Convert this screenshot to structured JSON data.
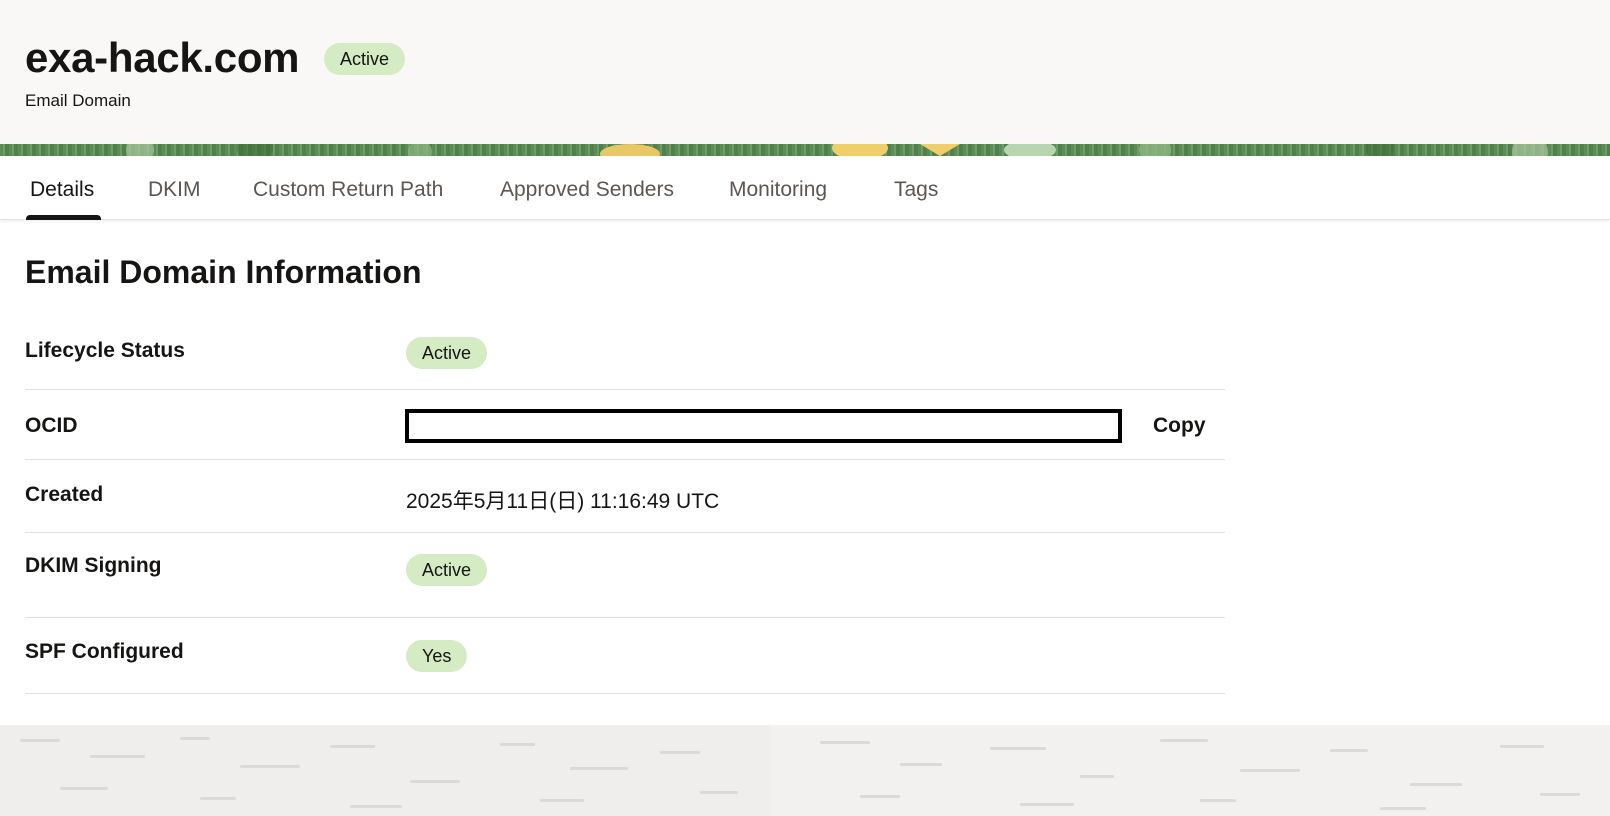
{
  "header": {
    "title": "exa-hack.com",
    "status_badge": "Active",
    "subtitle": "Email Domain"
  },
  "tabs": [
    {
      "label": "Details",
      "active": true
    },
    {
      "label": "DKIM",
      "active": false
    },
    {
      "label": "Custom Return Path",
      "active": false
    },
    {
      "label": "Approved Senders",
      "active": false
    },
    {
      "label": "Monitoring",
      "active": false
    },
    {
      "label": "Tags",
      "active": false
    }
  ],
  "section": {
    "title": "Email Domain Information"
  },
  "info": {
    "lifecycle_status": {
      "label": "Lifecycle Status",
      "value": "Active"
    },
    "ocid": {
      "label": "OCID",
      "value": "",
      "copy_label": "Copy"
    },
    "created": {
      "label": "Created",
      "value": "2025年5月11日(日) 11:16:49 UTC"
    },
    "dkim_signing": {
      "label": "DKIM Signing",
      "value": "Active"
    },
    "spf_configured": {
      "label": "SPF Configured",
      "value": "Yes"
    }
  },
  "colors": {
    "badge_bg": "#d4ebc3",
    "header_bg": "#faf8f6",
    "footer_bg": "#eeedeb",
    "text": "#161513"
  }
}
